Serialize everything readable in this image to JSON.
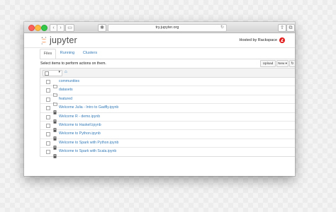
{
  "browser": {
    "url": "try.jupyter.org",
    "reload_glyph": "↻",
    "back_glyph": "‹",
    "forward_glyph": "›",
    "sidebar_glyph": "▭",
    "extension_glyph": "✱",
    "share_glyph": "⇧",
    "tabs_glyph": "⧉",
    "plus_glyph": "+"
  },
  "header": {
    "logo_text": "jupyter",
    "hosted_by": "Hosted by Rackspace",
    "colors": {
      "logo_orange": "#f37626",
      "rackspace_red": "#e11d1d"
    }
  },
  "tabs": [
    {
      "label": "Files",
      "active": true
    },
    {
      "label": "Running",
      "active": false
    },
    {
      "label": "Clusters",
      "active": false
    }
  ],
  "toolbar": {
    "hint": "Select items to perform actions on them.",
    "upload_label": "Upload",
    "new_label": "New ▾",
    "refresh_glyph": "↻",
    "home_glyph": "⌂"
  },
  "files": [
    {
      "name": "communities",
      "type": "folder-icon"
    },
    {
      "name": "datasets",
      "type": "folder-icon"
    },
    {
      "name": "featured",
      "type": "folder-icon"
    },
    {
      "name": "Welcome Julia - Intro to Gadfly.ipynb",
      "type": "notebook-icon"
    },
    {
      "name": "Welcome R - demo.ipynb",
      "type": "notebook-icon"
    },
    {
      "name": "Welcome to Haskell.ipynb",
      "type": "notebook-icon"
    },
    {
      "name": "Welcome to Python.ipynb",
      "type": "notebook-icon"
    },
    {
      "name": "Welcome to Spark with Python.ipynb",
      "type": "notebook-icon"
    },
    {
      "name": "Welcome to Spark with Scala.ipynb",
      "type": "notebook-icon"
    }
  ]
}
